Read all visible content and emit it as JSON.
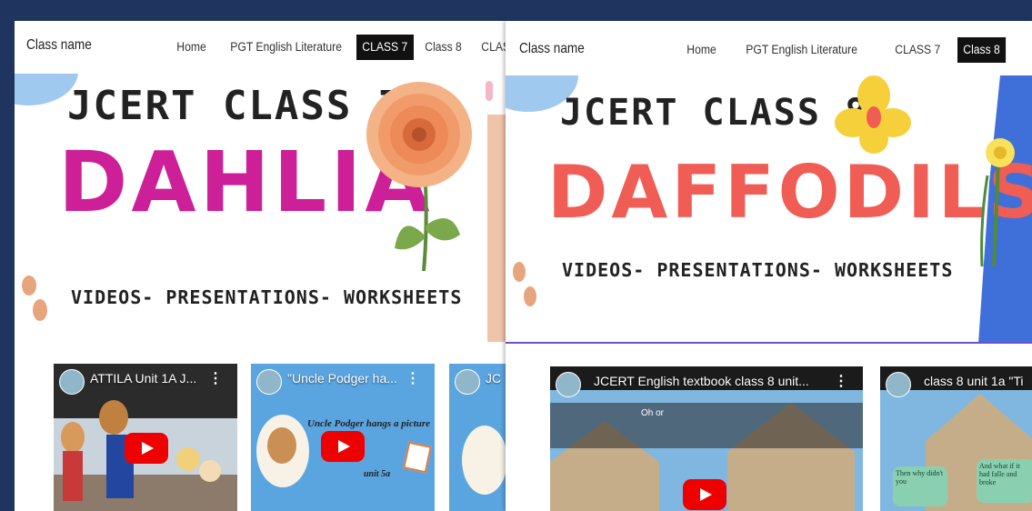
{
  "left_page": {
    "brand": "Class name",
    "nav": [
      "Home",
      "PGT English Literature",
      "CLASS 7",
      "Class 8",
      "CLASS"
    ],
    "active_nav": "CLASS 7",
    "banner": {
      "line1": "JCERT CLASS 7",
      "title": "DAHLIA",
      "line3": "VIDEOS- PRESENTATIONS- WORKSHEETS"
    },
    "videos": [
      {
        "title": "ATTILA Unit 1A J..."
      },
      {
        "title": "\"Uncle Podger ha...",
        "caption": "Uncle Podger hangs a picture",
        "caption2": "unit 5a"
      },
      {
        "title": "JC"
      }
    ]
  },
  "right_page": {
    "brand": "Class name",
    "nav": [
      "Home",
      "PGT English Literature",
      "CLASS 7",
      "Class 8"
    ],
    "active_nav": "Class 8",
    "banner": {
      "line1": "JCERT CLASS 8",
      "title": "DAFFODILS",
      "line3": "VIDEOS- PRESENTATIONS- WORKSHEETS"
    },
    "videos": [
      {
        "title": "JCERT English textbook class 8 unit...",
        "caption": "Oh or"
      },
      {
        "title": "class 8 unit 1a \"Ti",
        "bubble1": "Then why didn't you",
        "bubble2": "And what if it had falle and broke"
      }
    ]
  },
  "colors": {
    "background": "#1f3560",
    "dahlia_title": "#cc1f98",
    "daffodils_title": "#ef5d54",
    "play_button": "#ee0000"
  }
}
